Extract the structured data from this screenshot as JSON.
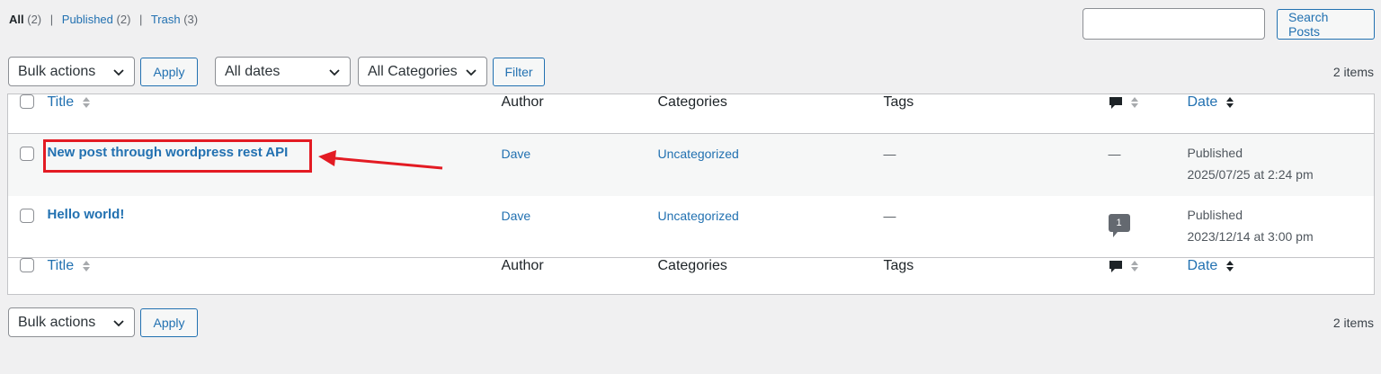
{
  "views": {
    "all_label": "All",
    "all_count": "(2)",
    "published_label": "Published",
    "published_count": "(2)",
    "trash_label": "Trash",
    "trash_count": "(3)",
    "separator": "|"
  },
  "search": {
    "input_value": "",
    "button_label": "Search Posts"
  },
  "top_nav": {
    "bulk_actions": "Bulk actions",
    "apply": "Apply",
    "dates": "All dates",
    "categories": "All Categories",
    "filter": "Filter",
    "items_count": "2 items"
  },
  "columns": {
    "title": "Title",
    "author": "Author",
    "categories": "Categories",
    "tags": "Tags",
    "date": "Date"
  },
  "posts": [
    {
      "title": "New post through wordpress rest API",
      "author": "Dave",
      "categories": "Uncategorized",
      "tags": "—",
      "comments": "—",
      "status": "Published",
      "date": "2025/07/25 at 2:24 pm"
    },
    {
      "title": "Hello world!",
      "author": "Dave",
      "categories": "Uncategorized",
      "tags": "—",
      "comments": "1",
      "status": "Published",
      "date": "2023/12/14 at 3:00 pm"
    }
  ],
  "bottom_nav": {
    "bulk_actions": "Bulk actions",
    "apply": "Apply",
    "items_count": "2 items"
  },
  "colors": {
    "link": "#2271b1",
    "annotation": "#e31b23",
    "background": "#f0f0f1"
  }
}
